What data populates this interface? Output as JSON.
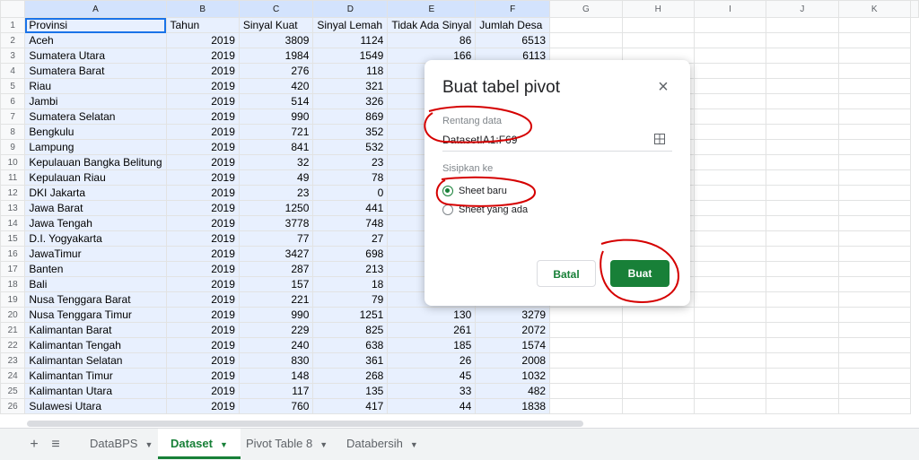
{
  "columns": [
    "A",
    "B",
    "C",
    "D",
    "E",
    "F",
    "G",
    "H",
    "I",
    "J",
    "K"
  ],
  "header_row": [
    "Provinsi",
    "Tahun",
    "Sinyal Kuat",
    "Sinyal Lemah",
    "Tidak Ada Sinyal",
    "Jumlah Desa"
  ],
  "rows": [
    [
      "Aceh",
      "2019",
      "3809",
      "1124",
      "86",
      "6513"
    ],
    [
      "Sumatera Utara",
      "2019",
      "1984",
      "1549",
      "166",
      "6113"
    ],
    [
      "Sumatera Barat",
      "2019",
      "276",
      "118",
      "",
      ""
    ],
    [
      "Riau",
      "2019",
      "420",
      "321",
      "",
      ""
    ],
    [
      "Jambi",
      "2019",
      "514",
      "326",
      "",
      ""
    ],
    [
      "Sumatera Selatan",
      "2019",
      "990",
      "869",
      "",
      ""
    ],
    [
      "Bengkulu",
      "2019",
      "721",
      "352",
      "",
      ""
    ],
    [
      "Lampung",
      "2019",
      "841",
      "532",
      "",
      ""
    ],
    [
      "Kepulauan Bangka Belitung",
      "2019",
      "32",
      "23",
      "",
      ""
    ],
    [
      "Kepulauan Riau",
      "2019",
      "49",
      "78",
      "",
      ""
    ],
    [
      "DKI Jakarta",
      "2019",
      "23",
      "0",
      "",
      ""
    ],
    [
      "Jawa Barat",
      "2019",
      "1250",
      "441",
      "",
      ""
    ],
    [
      "Jawa Tengah",
      "2019",
      "3778",
      "748",
      "",
      ""
    ],
    [
      "D.I. Yogyakarta",
      "2019",
      "77",
      "27",
      "",
      ""
    ],
    [
      "JawaTimur",
      "2019",
      "3427",
      "698",
      "",
      ""
    ],
    [
      "Banten",
      "2019",
      "287",
      "213",
      "",
      ""
    ],
    [
      "Bali",
      "2019",
      "157",
      "18",
      "",
      ""
    ],
    [
      "Nusa Tenggara Barat",
      "2019",
      "221",
      "79",
      "",
      ""
    ],
    [
      "Nusa Tenggara Timur",
      "2019",
      "990",
      "1251",
      "130",
      "3279"
    ],
    [
      "Kalimantan Barat",
      "2019",
      "229",
      "825",
      "261",
      "2072"
    ],
    [
      "Kalimantan Tengah",
      "2019",
      "240",
      "638",
      "185",
      "1574"
    ],
    [
      "Kalimantan Selatan",
      "2019",
      "830",
      "361",
      "26",
      "2008"
    ],
    [
      "Kalimantan Timur",
      "2019",
      "148",
      "268",
      "45",
      "1032"
    ],
    [
      "Kalimantan Utara",
      "2019",
      "117",
      "135",
      "33",
      "482"
    ],
    [
      "Sulawesi Utara",
      "2019",
      "760",
      "417",
      "44",
      "1838"
    ]
  ],
  "tabs": {
    "add_icon": "+",
    "list_icon": "≡",
    "items": [
      "DataBPS",
      "Dataset",
      "Pivot Table 8",
      "Databersih"
    ],
    "active": "Dataset"
  },
  "dialog": {
    "title": "Buat tabel pivot",
    "close_icon": "×",
    "range_label": "Rentang data",
    "range_value": "Dataset!A1:F69",
    "insert_label": "Sisipkan ke",
    "option_new": "Sheet baru",
    "option_existing": "Sheet yang ada",
    "cancel_label": "Batal",
    "create_label": "Buat"
  },
  "colors": {
    "accent_green": "#188038",
    "selection_blue": "#e8f0fe",
    "annotation_red": "#d50000"
  }
}
